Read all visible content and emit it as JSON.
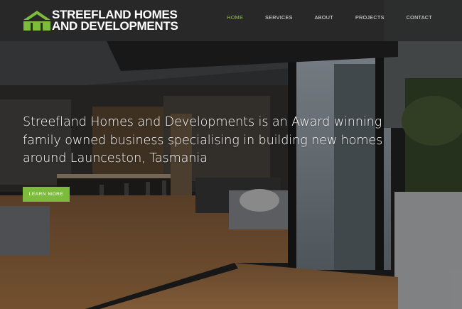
{
  "brand": {
    "line1": "STREEFLAND HOMES",
    "line2": "AND DEVELOPMENTS",
    "logo_icon": "house-roof-icon",
    "accent_color": "#7dbb3c"
  },
  "nav": {
    "items": [
      {
        "label": "HOME",
        "active": true
      },
      {
        "label": "SERVICES",
        "active": false
      },
      {
        "label": "ABOUT",
        "active": false
      },
      {
        "label": "PROJECTS",
        "active": false
      },
      {
        "label": "CONTACT",
        "active": false
      }
    ]
  },
  "hero": {
    "headline": "Streefland Homes and Developments is an Award winning family owned business specialising in building new homes around Launceston, Tasmania",
    "cta_label": "LEARN MORE"
  }
}
